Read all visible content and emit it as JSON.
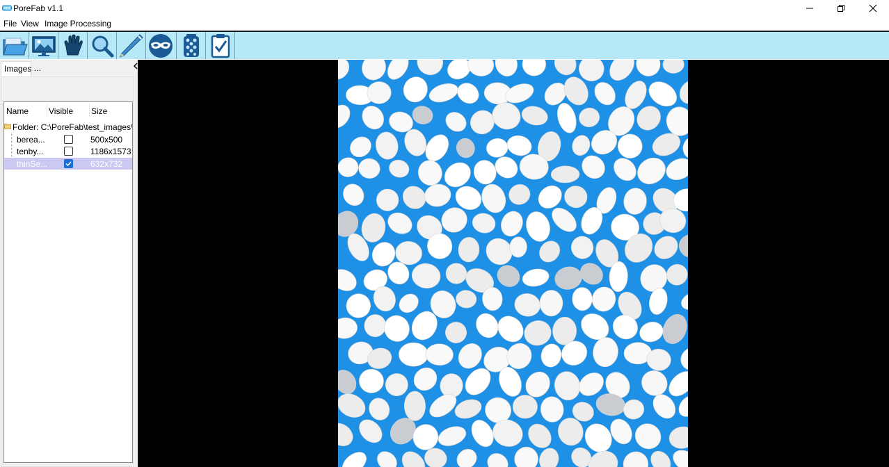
{
  "window": {
    "title": "PoreFab v1.1",
    "icon": "porefab-app-icon",
    "controls": [
      "minimize-icon",
      "maximize-icon",
      "close-icon"
    ]
  },
  "menu": {
    "items": [
      "File",
      "View",
      "Image Processing"
    ]
  },
  "toolbar": {
    "buttons": [
      {
        "name": "open-folder-icon"
      },
      {
        "name": "image-view-icon"
      },
      {
        "name": "hand-pan-icon"
      },
      {
        "name": "zoom-magnifier-icon"
      },
      {
        "name": "pencil-draw-icon"
      },
      {
        "name": "mask-icon"
      },
      {
        "name": "pore-column-icon"
      },
      {
        "name": "clipboard-check-icon"
      }
    ],
    "background": "#b6e8f8"
  },
  "left_panel": {
    "tabs": [
      "Images",
      "..."
    ],
    "columns": [
      "Name",
      "Visible",
      "Size"
    ],
    "folder_label": "Folder: C:\\PoreFab\\test_images\\",
    "rows": [
      {
        "name": "berea...",
        "visible": false,
        "size": "500x500"
      },
      {
        "name": "tenby...",
        "visible": false,
        "size": "1186x1573"
      },
      {
        "name": "thinSe...",
        "visible": true,
        "size": "632x732"
      }
    ],
    "selected_row": 2
  },
  "viewer": {
    "background": "#000000",
    "image_description_color": "#1e90e6"
  }
}
